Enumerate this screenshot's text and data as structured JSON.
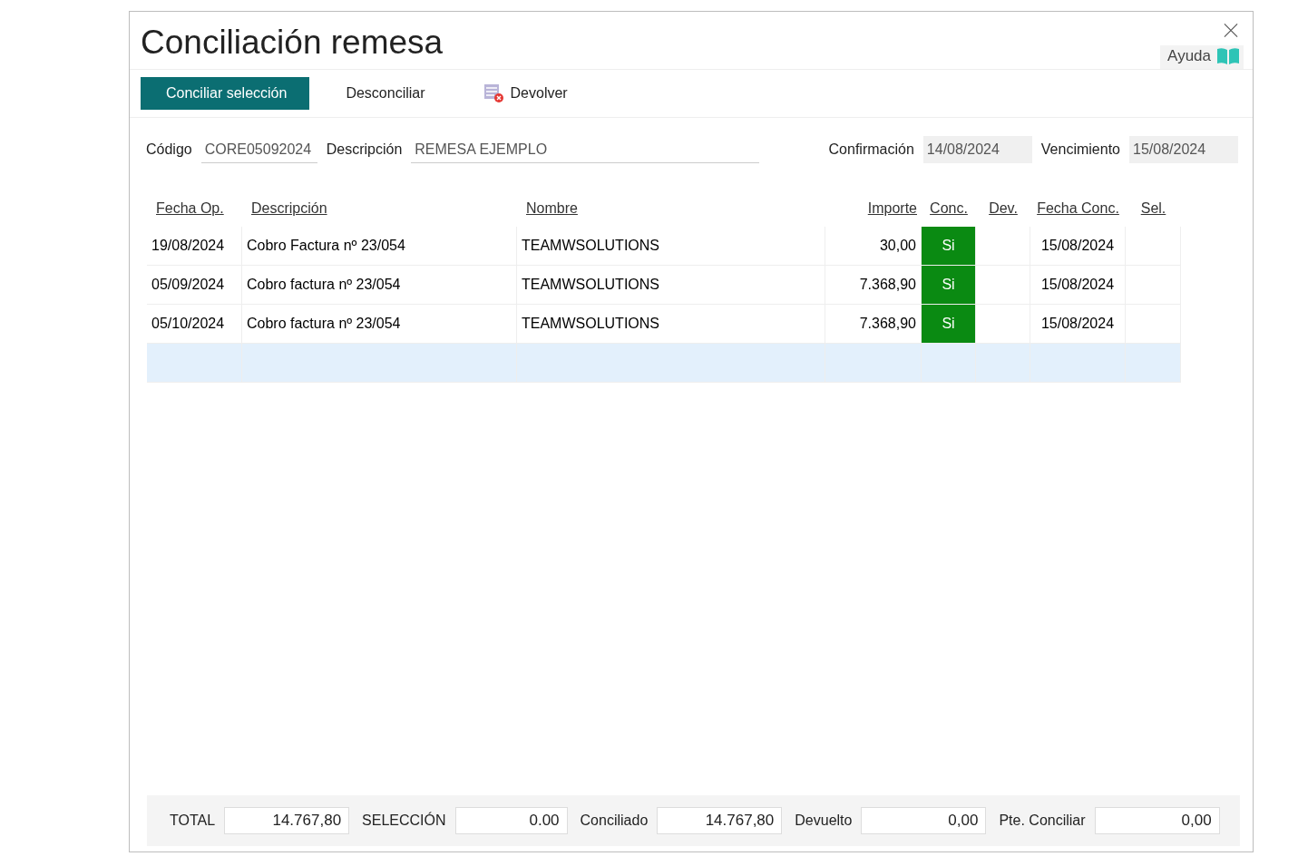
{
  "window": {
    "title": "Conciliación remesa",
    "help": "Ayuda"
  },
  "toolbar": [
    {
      "label": "Conciliar selección",
      "kind": "primary"
    },
    {
      "label": "Desconciliar",
      "kind": "plain"
    },
    {
      "label": "Devolver",
      "kind": "icon"
    }
  ],
  "fields": [
    {
      "label": "Código",
      "value": "CORE05092024",
      "kind": "underline"
    },
    {
      "label": "Descripción",
      "value": "REMESA EJEMPLO",
      "kind": "underline"
    },
    {
      "label": "Confirmación",
      "value": "14/08/2024",
      "kind": "filled"
    },
    {
      "label": "Vencimiento",
      "value": "15/08/2024",
      "kind": "filled"
    }
  ],
  "table": {
    "columns": [
      "Fecha Op.",
      "Descripción",
      "Nombre",
      "Importe",
      "Conc.",
      "Dev.",
      "Fecha Conc.",
      "Sel."
    ],
    "rows": [
      {
        "kind": "data",
        "selected": false,
        "fecha_op": "19/08/2024",
        "descripcion": "Cobro Factura nº 23/054",
        "nombre": "TEAMWSOLUTIONS",
        "importe": "30,00",
        "conc": "Si",
        "fecha_conc": "15/08/2024"
      },
      {
        "kind": "data",
        "selected": false,
        "fecha_op": "05/09/2024",
        "descripcion": "Cobro factura nº 23/054",
        "nombre": "TEAMWSOLUTIONS",
        "importe": "7.368,90",
        "conc": "Si",
        "fecha_conc": "15/08/2024"
      },
      {
        "kind": "data",
        "selected": false,
        "fecha_op": "05/10/2024",
        "descripcion": "Cobro factura nº 23/054",
        "nombre": "TEAMWSOLUTIONS",
        "importe": "7.368,90",
        "conc": "Si",
        "fecha_conc": "15/08/2024"
      },
      {
        "kind": "empty",
        "selected": true
      }
    ]
  },
  "totals": [
    {
      "label": "TOTAL",
      "value": "14.767,80"
    },
    {
      "label": "SELECCIÓN",
      "value": "0.00"
    },
    {
      "label": "Conciliado",
      "value": "14.767,80"
    },
    {
      "label": "Devuelto",
      "value": "0,00"
    },
    {
      "label": "Pte. Conciliar",
      "value": "0,00"
    }
  ]
}
